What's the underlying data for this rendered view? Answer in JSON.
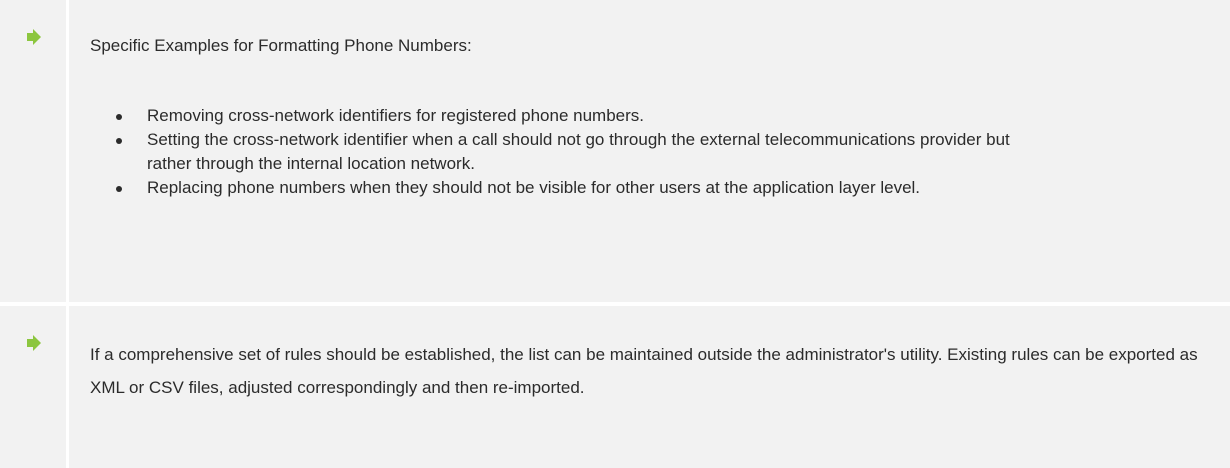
{
  "icons": {
    "arrow": "right-arrow-icon",
    "arrow_color": "#8cc63f"
  },
  "note1": {
    "heading": "Specific Examples for Formatting Phone Numbers:",
    "bullets": [
      "Removing cross-network identifiers for registered phone numbers.",
      "Setting the cross-network identifier when a call should not go through the external telecommunications provider but rather through the internal location network.",
      "Replacing phone numbers when they should not be visible for other users at the application layer level."
    ]
  },
  "note2": {
    "text": "If a comprehensive set of rules should be established, the list can be maintained outside the administrator's utility. Existing rules can be exported as XML or CSV files, adjusted correspondingly and then re-imported."
  }
}
